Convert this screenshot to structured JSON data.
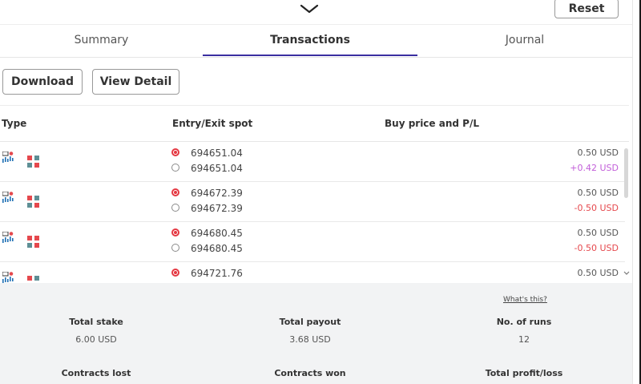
{
  "header": {
    "reset_label": "Reset"
  },
  "tabs": [
    {
      "label": "Summary"
    },
    {
      "label": "Transactions"
    },
    {
      "label": "Journal"
    }
  ],
  "actions": {
    "download_label": "Download",
    "view_detail_label": "View Detail"
  },
  "table": {
    "columns": [
      "Type",
      "Entry/Exit spot",
      "Buy price and P/L"
    ],
    "rows": [
      {
        "entry": "694651.04",
        "exit": "694651.04",
        "price": "0.50 USD",
        "pl": "+0.42 USD"
      },
      {
        "entry": "694672.39",
        "exit": "694672.39",
        "price": "0.50 USD",
        "pl": "-0.50 USD"
      },
      {
        "entry": "694680.45",
        "exit": "694680.45",
        "price": "0.50 USD",
        "pl": "-0.50 USD"
      },
      {
        "entry": "694721.76",
        "exit": "",
        "price": "0.50 USD",
        "pl": ""
      }
    ]
  },
  "summary": {
    "whats_this": "What's this?",
    "total_stake_label": "Total stake",
    "total_stake_value": "6.00 USD",
    "total_payout_label": "Total payout",
    "total_payout_value": "3.68 USD",
    "runs_label": "No. of runs",
    "runs_value": "12",
    "contracts_lost_label": "Contracts lost",
    "contracts_won_label": "Contracts won",
    "total_pl_label": "Total profit/loss"
  },
  "colors": {
    "profit": "#c25ed9",
    "loss": "#e5484d",
    "tab_accent": "#3a2fa0",
    "entry_marker": "#e53842"
  },
  "icons": {
    "header": "chevron-down-icon",
    "type": "chart-type-icon",
    "blocks": "digit-blocks-icon",
    "entry": "entry-spot-icon",
    "exit": "exit-spot-icon"
  }
}
